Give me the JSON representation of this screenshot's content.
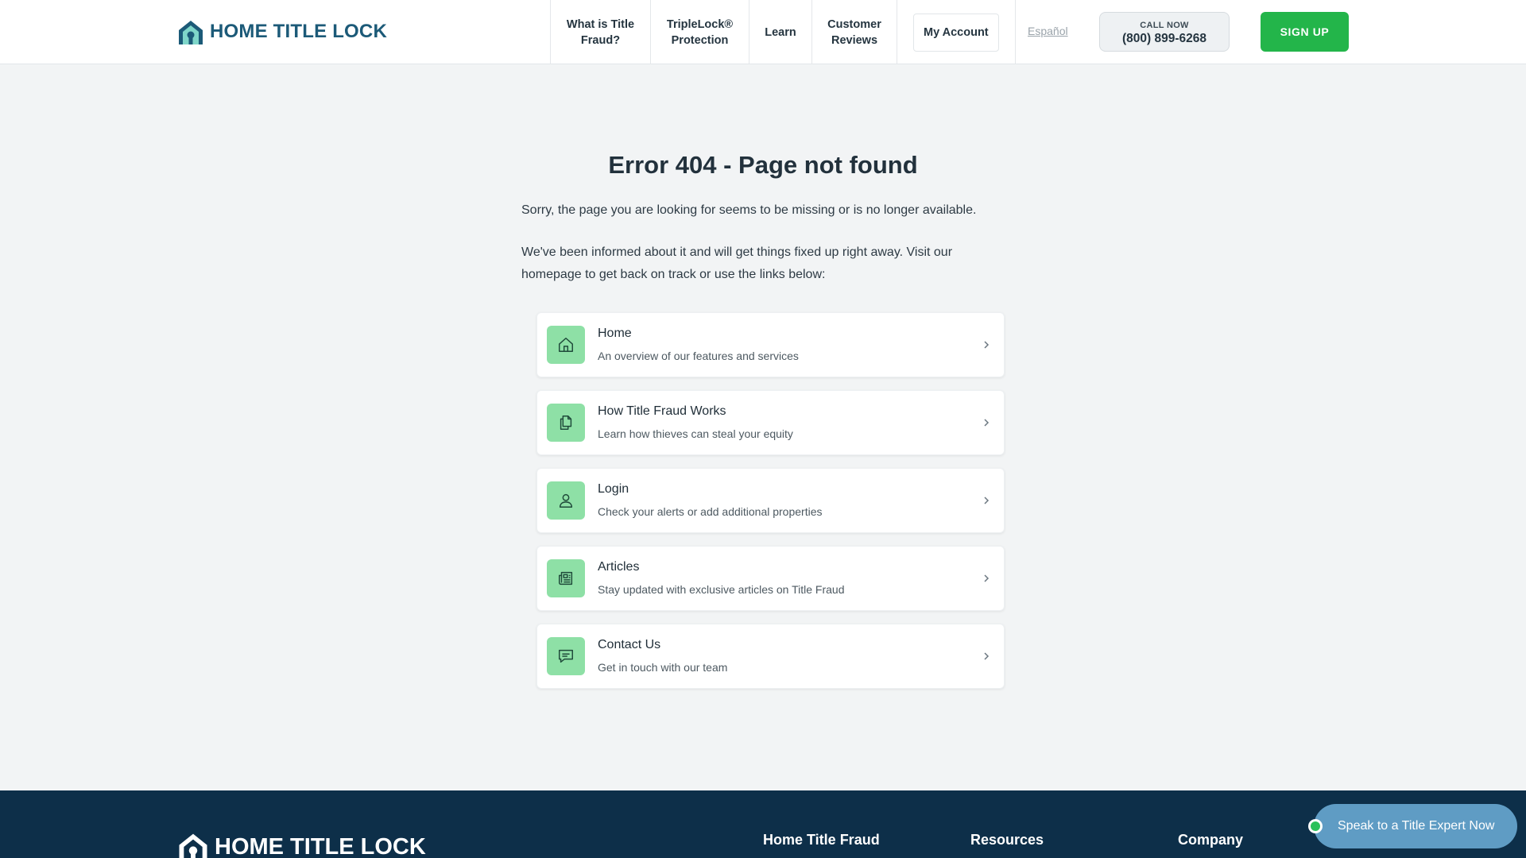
{
  "header": {
    "logo_text": "HOME TITLE LOCK",
    "nav": [
      {
        "label": "What is Title\nFraud?"
      },
      {
        "label": "TripleLock®\nProtection"
      },
      {
        "label": "Learn"
      },
      {
        "label": "Customer\nReviews"
      }
    ],
    "my_account": "My Account",
    "language": "Español",
    "call_label": "CALL NOW",
    "call_number": "(800) 899-6268",
    "signup": "SIGN UP"
  },
  "main": {
    "title": "Error 404 - Page not found",
    "para1": "Sorry, the page you are looking for seems to be missing or is no longer available.",
    "para2": "We've been informed about it and will get things fixed up right away. Visit our homepage to get back on track or use the links below:",
    "links": [
      {
        "title": "Home",
        "desc": "An overview of our features and services",
        "icon": "home-icon"
      },
      {
        "title": "How Title Fraud Works",
        "desc": "Learn how thieves can steal your equity",
        "icon": "documents-icon"
      },
      {
        "title": "Login",
        "desc": "Check your alerts or add additional properties",
        "icon": "user-icon"
      },
      {
        "title": "Articles",
        "desc": "Stay updated with exclusive articles on Title Fraud",
        "icon": "newspaper-icon"
      },
      {
        "title": "Contact Us",
        "desc": "Get in touch with our team",
        "icon": "chat-icon"
      }
    ]
  },
  "footer": {
    "logo_text": "HOME TITLE LOCK",
    "col1": "Home Title Fraud",
    "col2": "Resources",
    "col3": "Company"
  },
  "chat_widget": "Speak to a Title Expert Now",
  "colors": {
    "brand": "#1c5a78",
    "accent_green": "#23b54a",
    "footer_bg": "#0d2f49",
    "icon_bg": "#8ee0a6"
  }
}
